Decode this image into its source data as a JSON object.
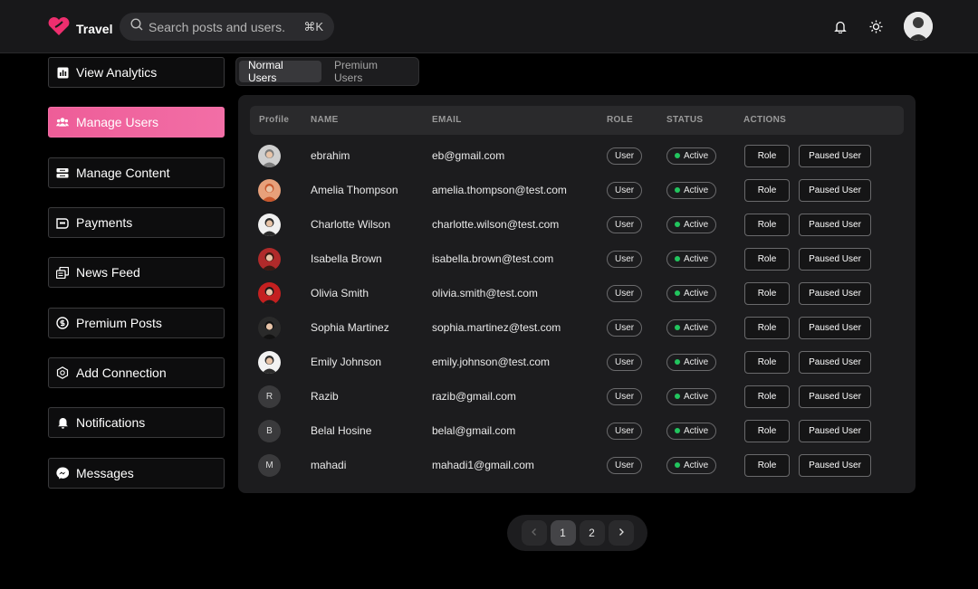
{
  "app": {
    "brand": "Travel",
    "brand_color": "#ee2e6e",
    "accent_color": "#f26ea6"
  },
  "search": {
    "placeholder": "Search posts and users..",
    "shortcut": "⌘K"
  },
  "header_icons": [
    "bell-icon",
    "sun-icon"
  ],
  "sidebar": {
    "items": [
      {
        "label": "View Analytics",
        "icon": "chart-icon",
        "active": false
      },
      {
        "label": "Manage Users",
        "icon": "users-icon",
        "active": true
      },
      {
        "label": "Manage Content",
        "icon": "content-icon",
        "active": false
      },
      {
        "label": "Payments",
        "icon": "payments-icon",
        "active": false
      },
      {
        "label": "News Feed",
        "icon": "newsfeed-icon",
        "active": false
      },
      {
        "label": "Premium Posts",
        "icon": "dollar-icon",
        "active": false
      },
      {
        "label": "Add Connection",
        "icon": "connection-icon",
        "active": false
      },
      {
        "label": "Notifications",
        "icon": "bell-icon",
        "active": false
      },
      {
        "label": "Messages",
        "icon": "messenger-icon",
        "active": false
      }
    ]
  },
  "tabs": [
    {
      "label": "Normal Users",
      "active": true
    },
    {
      "label": "Premium Users",
      "active": false
    }
  ],
  "table": {
    "headers": {
      "profile": "Profile",
      "name": "NAME",
      "email": "EMAIL",
      "role": "ROLE",
      "status": "STATUS",
      "actions": "ACTIONS"
    },
    "rows": [
      {
        "avatar": "photo",
        "initial": "",
        "name": "ebrahim",
        "email": "eb@gmail.com",
        "role": "User",
        "status": "Active",
        "action1": "Role",
        "action2": "Paused User"
      },
      {
        "avatar": "photo",
        "initial": "",
        "name": "Amelia Thompson",
        "email": "amelia.thompson@test.com",
        "role": "User",
        "status": "Active",
        "action1": "Role",
        "action2": "Paused User"
      },
      {
        "avatar": "photo",
        "initial": "",
        "name": "Charlotte Wilson",
        "email": "charlotte.wilson@test.com",
        "role": "User",
        "status": "Active",
        "action1": "Role",
        "action2": "Paused User"
      },
      {
        "avatar": "photo",
        "initial": "",
        "name": "Isabella Brown",
        "email": "isabella.brown@test.com",
        "role": "User",
        "status": "Active",
        "action1": "Role",
        "action2": "Paused User"
      },
      {
        "avatar": "photo",
        "initial": "",
        "name": "Olivia Smith",
        "email": "olivia.smith@test.com",
        "role": "User",
        "status": "Active",
        "action1": "Role",
        "action2": "Paused User"
      },
      {
        "avatar": "photo",
        "initial": "",
        "name": "Sophia Martinez",
        "email": "sophia.martinez@test.com",
        "role": "User",
        "status": "Active",
        "action1": "Role",
        "action2": "Paused User"
      },
      {
        "avatar": "photo",
        "initial": "",
        "name": "Emily Johnson",
        "email": "emily.johnson@test.com",
        "role": "User",
        "status": "Active",
        "action1": "Role",
        "action2": "Paused User"
      },
      {
        "avatar": "initial",
        "initial": "R",
        "name": "Razib",
        "email": "razib@gmail.com",
        "role": "User",
        "status": "Active",
        "action1": "Role",
        "action2": "Paused User"
      },
      {
        "avatar": "initial",
        "initial": "B",
        "name": "Belal Hosine",
        "email": "belal@gmail.com",
        "role": "User",
        "status": "Active",
        "action1": "Role",
        "action2": "Paused User"
      },
      {
        "avatar": "initial",
        "initial": "M",
        "name": "mahadi",
        "email": "mahadi1@gmail.com",
        "role": "User",
        "status": "Active",
        "action1": "Role",
        "action2": "Paused User"
      }
    ]
  },
  "pagination": {
    "prev_icon": "chevron-left-icon",
    "next_icon": "chevron-right-icon",
    "pages": [
      "1",
      "2"
    ],
    "current": "1"
  },
  "status_color": "#22c55e"
}
